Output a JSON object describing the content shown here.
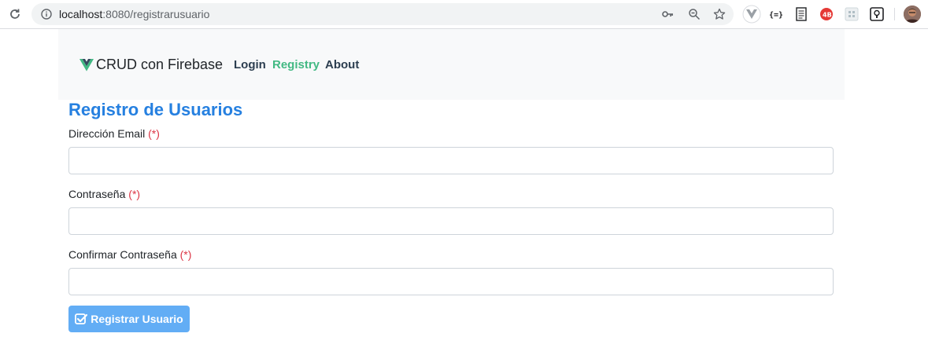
{
  "browser": {
    "url_host": "localhost",
    "url_path": ":8080/registrarusuario",
    "icons": [
      "reload-icon",
      "info-icon",
      "key-icon",
      "zoom-icon",
      "star-icon"
    ],
    "extensions": [
      "vue-devtools-icon",
      "json-formatter-icon",
      "document-icon",
      "react-extension-icon",
      "grid-extension-icon",
      "lightbulb-extension-icon"
    ]
  },
  "navbar": {
    "brand": "CRUD con Firebase",
    "links": {
      "login": "Login",
      "registry": "Registry",
      "about": "About"
    },
    "colors": {
      "active": "#42b983",
      "inactive": "#2c3e50",
      "background": "#f8f9fa"
    }
  },
  "form": {
    "title": "Registro de Usuarios",
    "required_marker": "(*)",
    "fields": {
      "email": {
        "label": "Dirección Email",
        "value": ""
      },
      "password": {
        "label": "Contraseña",
        "value": ""
      },
      "confirm_password": {
        "label": "Confirmar Contraseña",
        "value": ""
      }
    },
    "submit_label": "Registrar Usuario",
    "colors": {
      "title": "#2680e0",
      "required": "#dc3545",
      "button": "#5aa9f5"
    }
  }
}
